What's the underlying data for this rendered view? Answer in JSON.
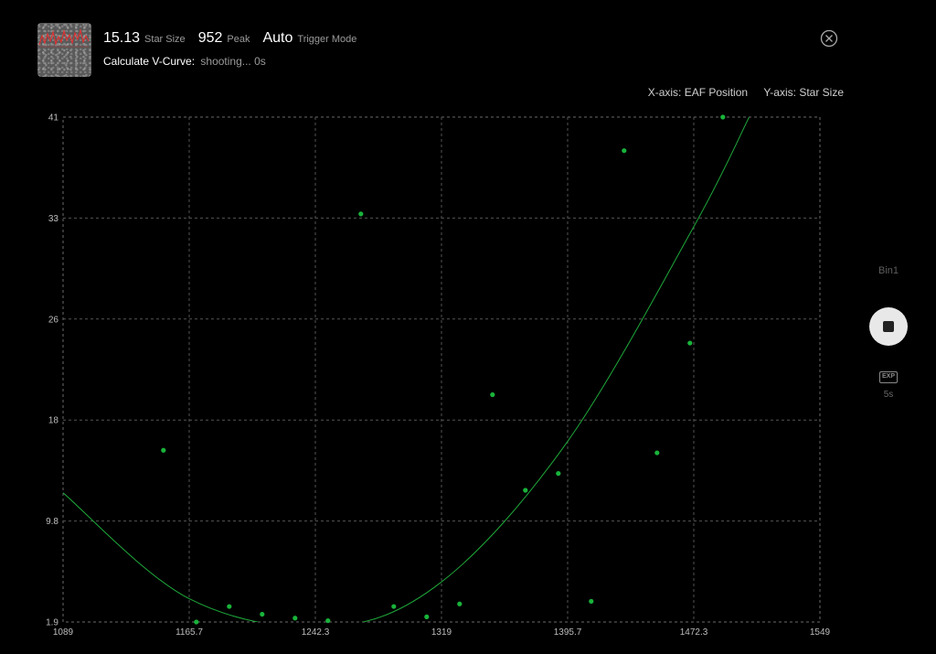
{
  "header": {
    "star_size_value": "15.13",
    "star_size_label": "Star Size",
    "peak_value": "952",
    "peak_label": "Peak",
    "trigger_value": "Auto",
    "trigger_label": "Trigger Mode",
    "vcurve_label": "Calculate V-Curve:",
    "vcurve_status": "shooting... 0s"
  },
  "axis_info": {
    "x_axis": "X-axis: EAF Position",
    "y_axis": "Y-axis: Star Size"
  },
  "side_panel": {
    "bin_label": "Bin1",
    "exp_icon_text": "EXP",
    "exp_value": "5s"
  },
  "icons": {
    "close": "close-circle-icon",
    "stop": "stop-icon",
    "exposure": "exp-icon"
  },
  "colors": {
    "background": "#000000",
    "grid": "#555555",
    "points": "#19b33a",
    "curve": "#1fa83a",
    "thumbnail_trace": "#e03030"
  },
  "chart_data": {
    "type": "scatter",
    "xlabel": "EAF Position",
    "ylabel": "Star Size",
    "x_ticks": [
      "1089",
      "1165.7",
      "1242.3",
      "1319",
      "1395.7",
      "1472.3",
      "1549"
    ],
    "y_ticks": [
      "1.9",
      "9.8",
      "18",
      "26",
      "33",
      "41"
    ],
    "xlim": [
      1089,
      1549
    ],
    "ylim": [
      1.9,
      41
    ],
    "grid": true,
    "points": [
      {
        "x": 1150,
        "y": 15.2
      },
      {
        "x": 1170,
        "y": 1.9
      },
      {
        "x": 1190,
        "y": 3.1
      },
      {
        "x": 1210,
        "y": 2.5
      },
      {
        "x": 1230,
        "y": 2.2
      },
      {
        "x": 1250,
        "y": 2.0
      },
      {
        "x": 1270,
        "y": 33.5
      },
      {
        "x": 1290,
        "y": 3.1
      },
      {
        "x": 1310,
        "y": 2.3
      },
      {
        "x": 1330,
        "y": 3.3
      },
      {
        "x": 1350,
        "y": 19.5
      },
      {
        "x": 1370,
        "y": 12.1
      },
      {
        "x": 1390,
        "y": 13.4
      },
      {
        "x": 1410,
        "y": 3.5
      },
      {
        "x": 1430,
        "y": 38.4
      },
      {
        "x": 1450,
        "y": 15.0
      },
      {
        "x": 1470,
        "y": 23.5
      },
      {
        "x": 1490,
        "y": 41.0
      }
    ],
    "fit_curve": {
      "type": "quadratic",
      "points": [
        {
          "x": 1089,
          "y": 11.9
        },
        {
          "x": 1165.7,
          "y": 3.7
        },
        {
          "x": 1250,
          "y": 1.5
        },
        {
          "x": 1319,
          "y": 5.0
        },
        {
          "x": 1395.7,
          "y": 15.9
        },
        {
          "x": 1472.3,
          "y": 32.5
        },
        {
          "x": 1506,
          "y": 41.0
        }
      ]
    }
  }
}
